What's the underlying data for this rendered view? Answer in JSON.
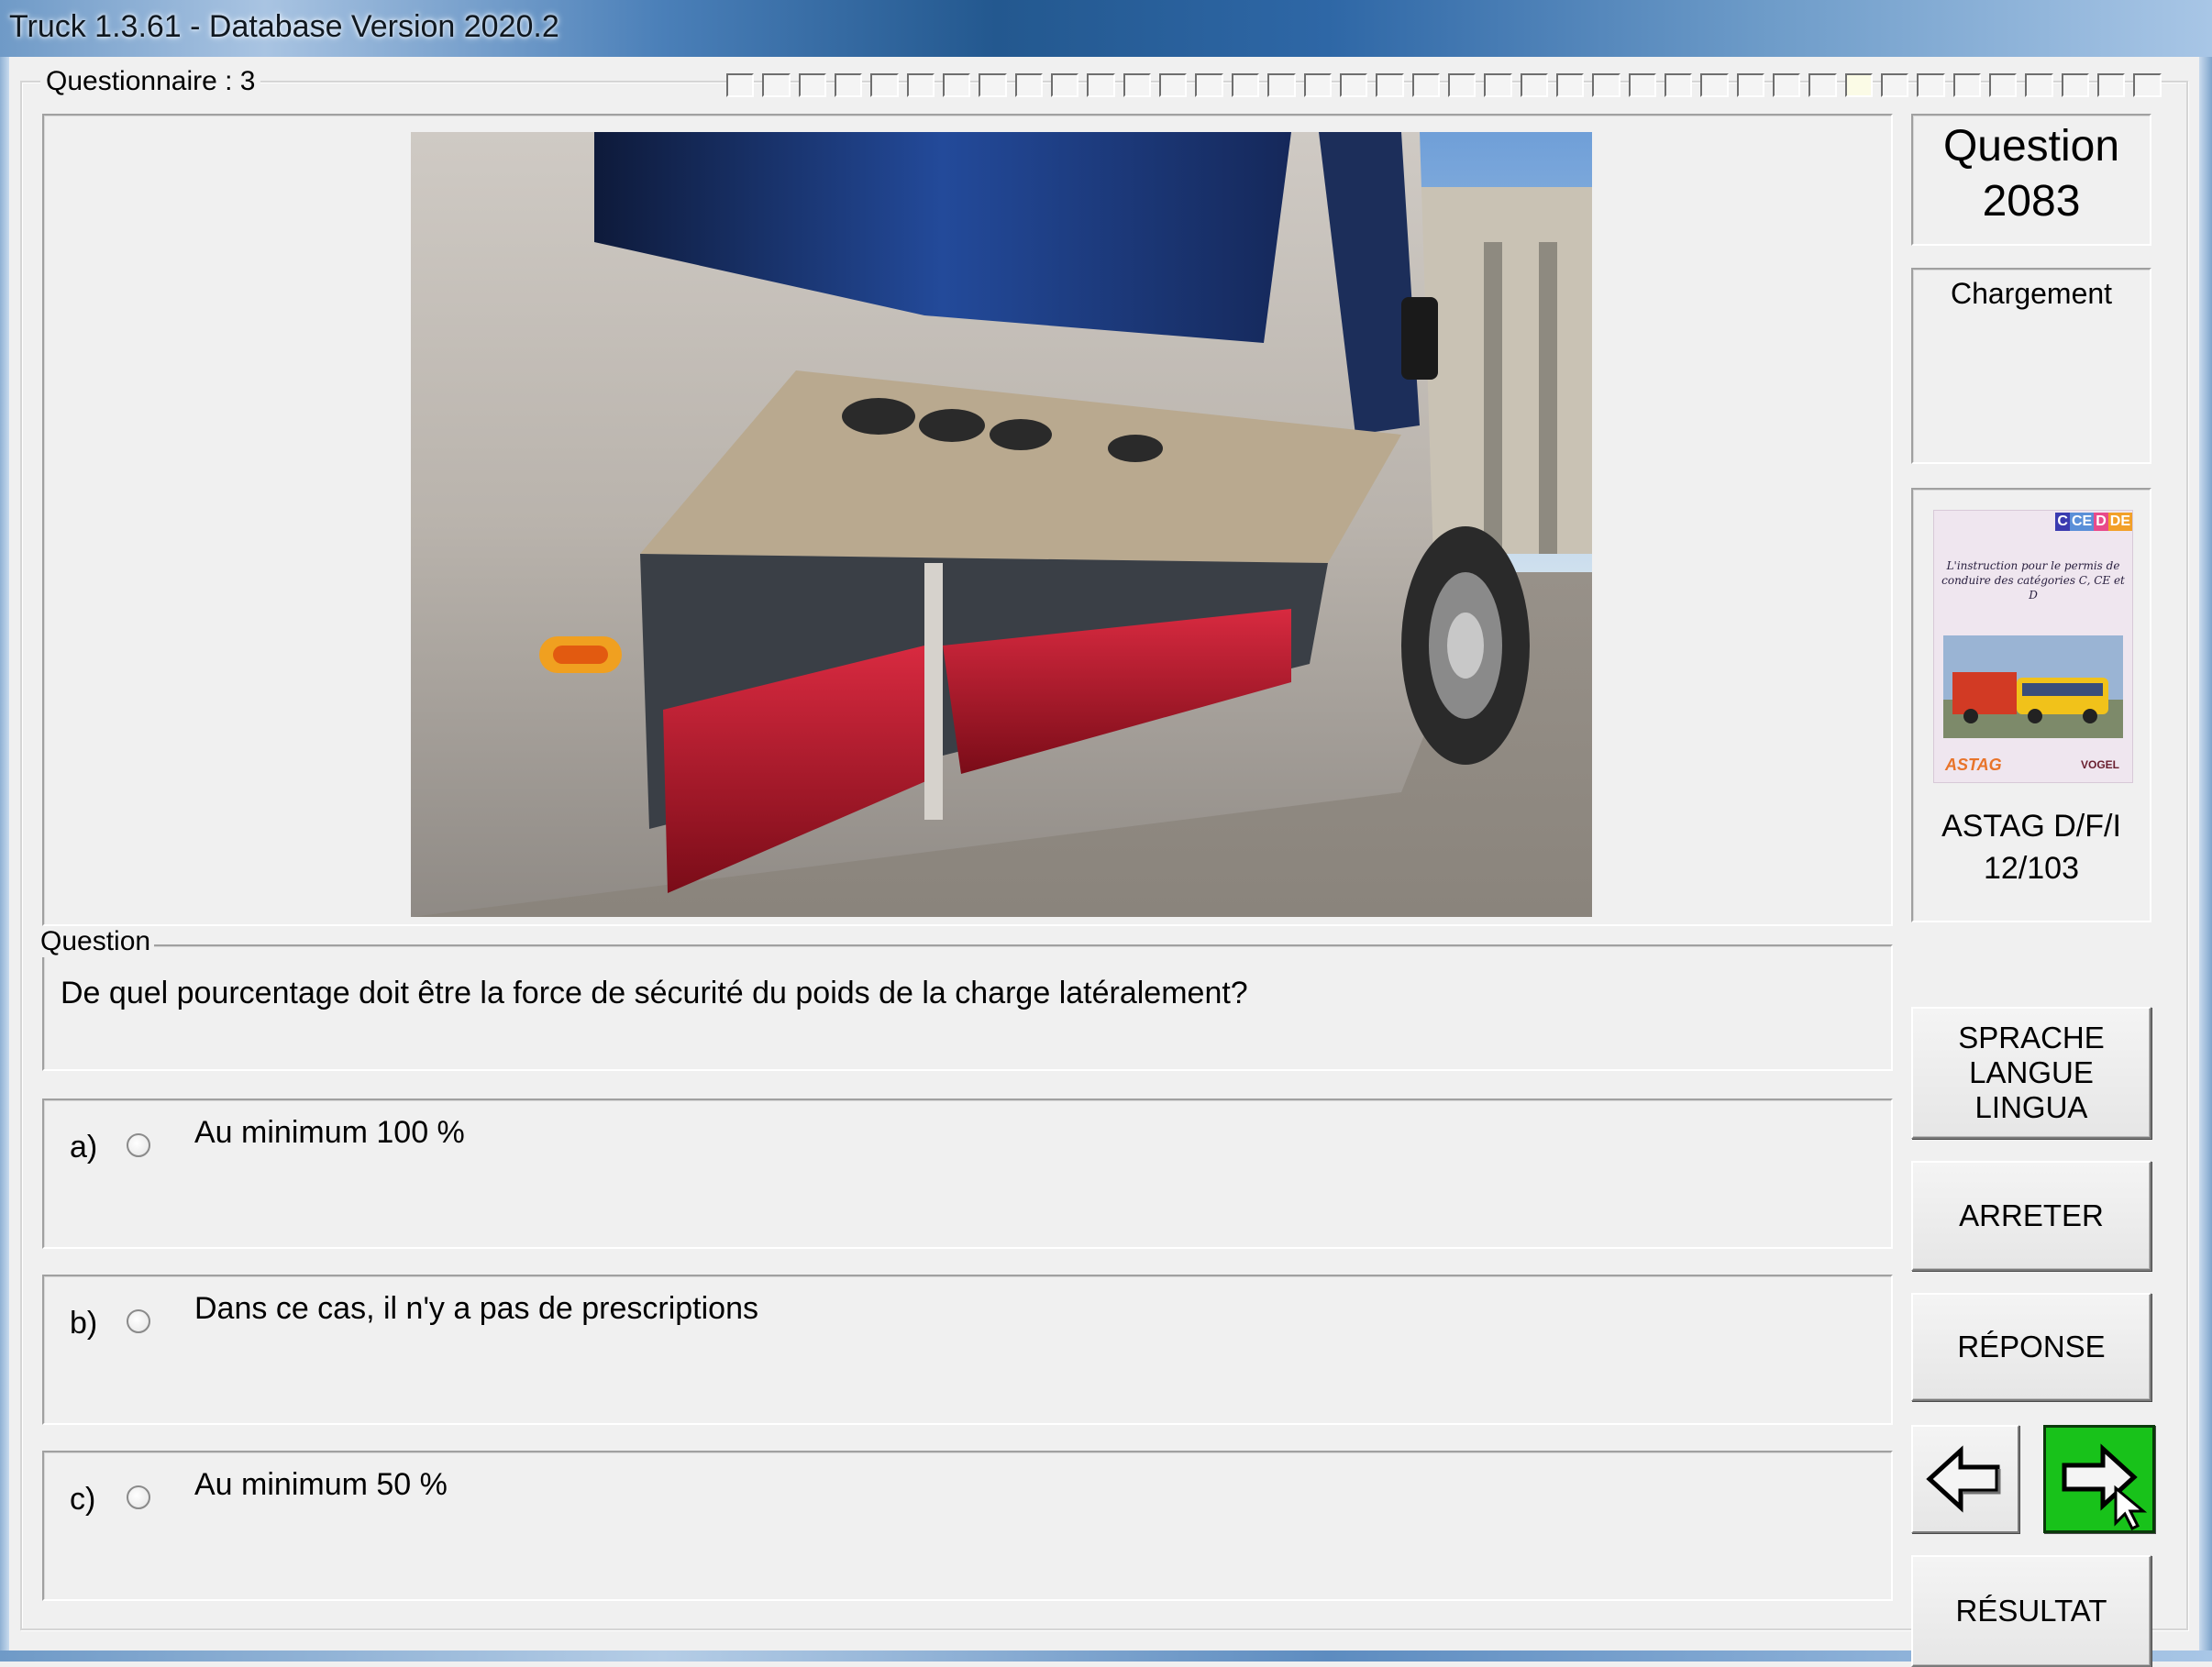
{
  "window": {
    "title": "Truck 1.3.61 - Database Version 2020.2"
  },
  "questionnaire": {
    "label": "Questionnaire : 3",
    "progress_total": 40,
    "progress_current": 32
  },
  "question": {
    "legend": "Question",
    "text": "De quel pourcentage doit être la force de sécurité du poids de la charge latéralement?",
    "number_label": "Question",
    "number": "2083",
    "category": "Chargement"
  },
  "answers": [
    {
      "letter": "a)",
      "text": "Au minimum 100 %"
    },
    {
      "letter": "b)",
      "text": "Dans ce cas, il n'y a pas de prescriptions"
    },
    {
      "letter": "c)",
      "text": "Au minimum 50 %"
    }
  ],
  "source_book": {
    "tags": [
      "C",
      "CE",
      "D",
      "DE"
    ],
    "tag_colors": [
      "#3b3bb0",
      "#5a8fd8",
      "#e84a8a",
      "#f2a028"
    ],
    "description": "L'instruction pour le permis de conduire des catégories C, CE et D",
    "logo_left": "ASTAG",
    "logo_right": "VOGEL",
    "reference": "ASTAG D/F/I",
    "pages": "12/103"
  },
  "buttons": {
    "language": "SPRACHE\nLANGUE\nLINGUA",
    "stop": "ARRETER",
    "answer": "RÉPONSE",
    "result": "RÉSULTAT",
    "back_icon": "arrow-left-icon",
    "next_icon": "arrow-right-icon"
  },
  "colors": {
    "next_button": "#18c21a",
    "title_bar": "#2e67a6"
  }
}
